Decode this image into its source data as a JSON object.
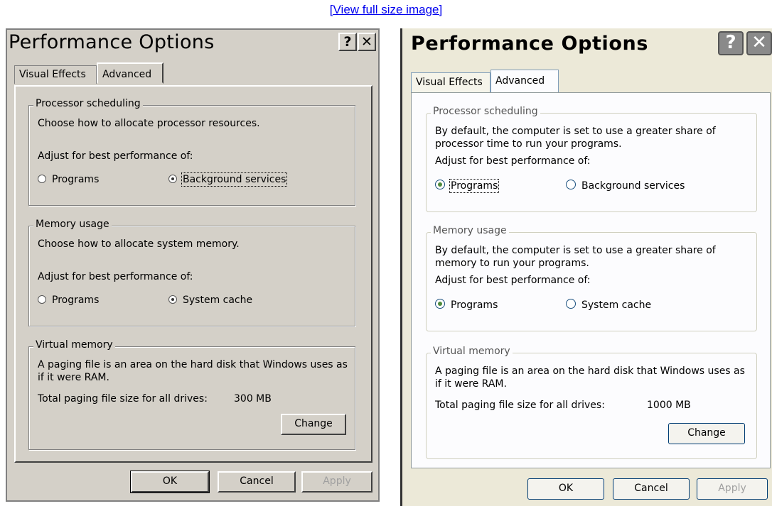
{
  "caption": "[View full size image]",
  "left": {
    "title": "Performance Options",
    "help_btn": "?",
    "close_btn": "✕",
    "tabs": [
      "Visual Effects",
      "Advanced"
    ],
    "proc": {
      "legend": "Processor scheduling",
      "desc": "Choose how to allocate processor resources.",
      "adjust": "Adjust for best performance of:",
      "opt1": "Programs",
      "opt2": "Background services",
      "selected": "Background services"
    },
    "mem": {
      "legend": "Memory usage",
      "desc": "Choose how to allocate system memory.",
      "adjust": "Adjust for best performance of:",
      "opt1": "Programs",
      "opt2": "System cache",
      "selected": "System cache"
    },
    "vm": {
      "legend": "Virtual memory",
      "desc": "A paging file is an area on the hard disk that Windows uses as if it were RAM.",
      "total_label": "Total paging file size for all drives:",
      "total_value": "300 MB",
      "change": "Change"
    },
    "buttons": {
      "ok": "OK",
      "cancel": "Cancel",
      "apply": "Apply"
    }
  },
  "right": {
    "title": "Performance Options",
    "help_btn": "?",
    "close_btn": "✕",
    "tabs": [
      "Visual Effects",
      "Advanced"
    ],
    "proc": {
      "legend": "Processor scheduling",
      "desc": "By default, the computer is set to use a greater share of processor time to run your programs.",
      "adjust": "Adjust for best performance of:",
      "opt1": "Programs",
      "opt2": "Background services",
      "selected": "Programs"
    },
    "mem": {
      "legend": "Memory usage",
      "desc": "By default, the computer is set to use a greater share of memory to run your programs.",
      "adjust": "Adjust for best performance of:",
      "opt1": "Programs",
      "opt2": "System cache",
      "selected": "Programs"
    },
    "vm": {
      "legend": "Virtual memory",
      "desc": "A paging file is an area on the hard disk that Windows uses as if it were RAM.",
      "total_label": "Total paging file size for all drives:",
      "total_value": "1000 MB",
      "change": "Change"
    },
    "buttons": {
      "ok": "OK",
      "cancel": "Cancel",
      "apply": "Apply"
    }
  }
}
